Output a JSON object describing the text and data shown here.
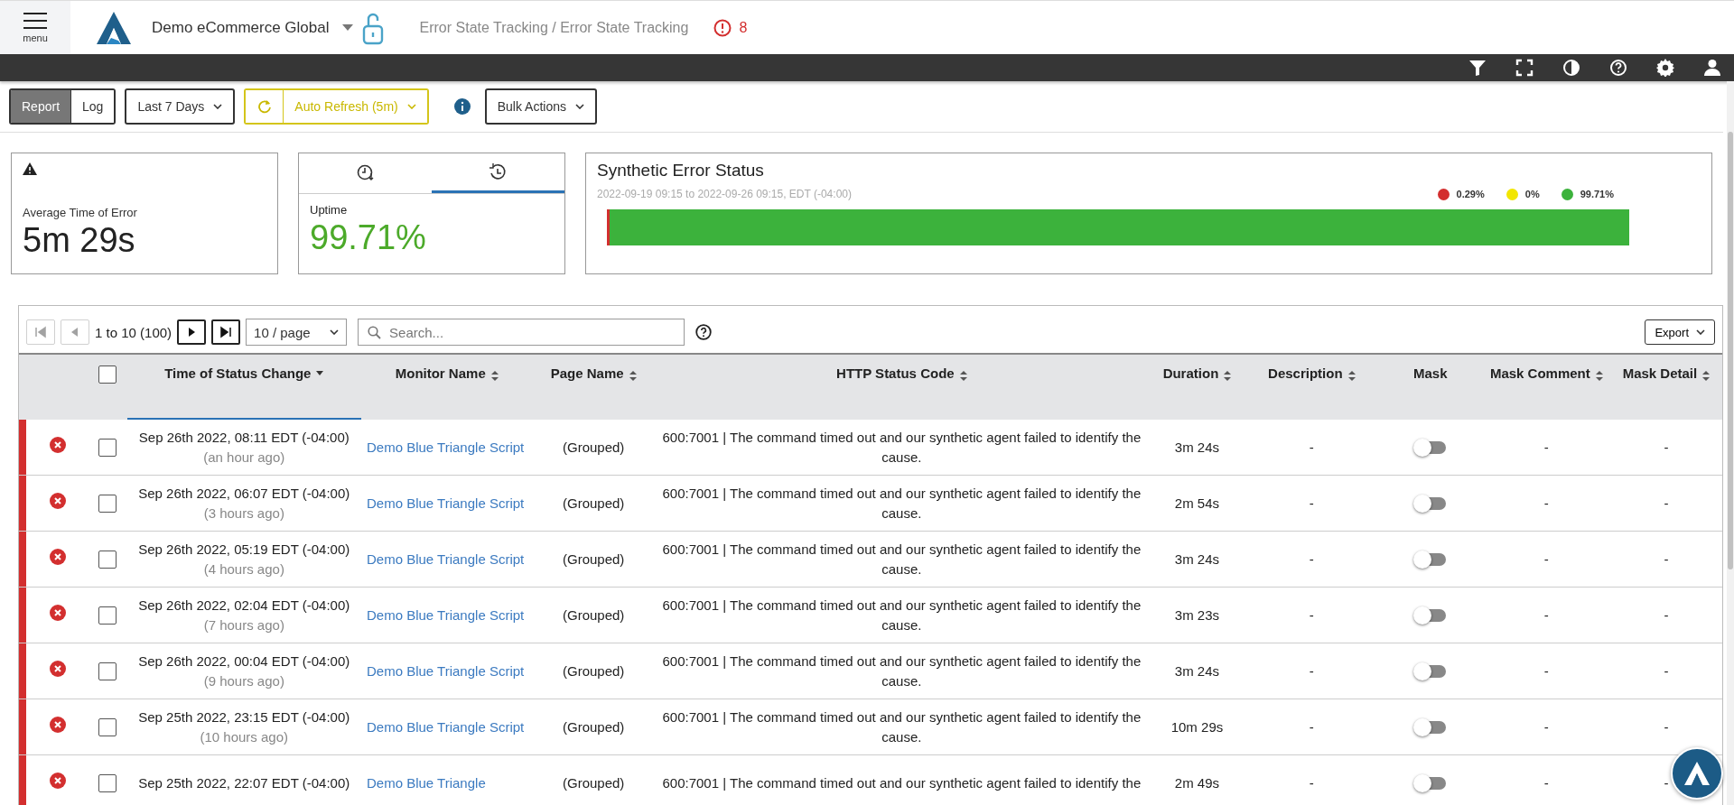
{
  "header": {
    "menu_label": "menu",
    "account": "Demo eCommerce Global",
    "breadcrumb": "Error State Tracking / Error State Tracking",
    "alert_count": "8"
  },
  "toolbar": {
    "view_toggle": [
      {
        "label": "Report",
        "selected": true
      },
      {
        "label": "Log",
        "selected": false
      }
    ],
    "date_range": "Last 7 Days",
    "auto_refresh": "Auto Refresh (5m)",
    "bulk_actions": "Bulk Actions"
  },
  "average_card": {
    "label": "Average Time of Error",
    "value": "5m 29s"
  },
  "uptime_card": {
    "tabs": [
      {
        "kind": "clock-down",
        "selected": false
      },
      {
        "kind": "clock-history",
        "selected": true
      }
    ],
    "label": "Uptime",
    "value": "99.71%"
  },
  "status_card": {
    "title": "Synthetic Error Status",
    "range": "2022-09-19 09:15 to 2022-09-26 09:15, EDT (-04:00)",
    "legend": [
      {
        "label": "0.29%",
        "color": "#d32f2f"
      },
      {
        "label": "0%",
        "color": "#f2e600"
      },
      {
        "label": "99.71%",
        "color": "#3cb23c"
      }
    ],
    "segments": [
      {
        "color": "#d32f2f",
        "level": 0.0029
      },
      {
        "color": "#3cb23c",
        "level": 0.9971
      }
    ]
  },
  "table": {
    "range": "1 to 10 (100)",
    "page_size": "10 / page",
    "search_placeholder": "Search...",
    "export": "Export",
    "all_checked": false,
    "columns": [
      {
        "label": "Time of Status Change",
        "sortable": true,
        "sorted": true
      },
      {
        "label": "Monitor Name",
        "sortable": true,
        "sorted": false
      },
      {
        "label": "Page Name",
        "sortable": true,
        "sorted": false
      },
      {
        "label": "HTTP Status Code",
        "sortable": true,
        "sorted": false
      },
      {
        "label": "Duration",
        "sortable": true,
        "sorted": false
      },
      {
        "label": "Description",
        "sortable": true,
        "sorted": false
      },
      {
        "label": "Mask",
        "sortable": false,
        "sorted": false
      },
      {
        "label": "Mask Comment",
        "sortable": true,
        "sorted": false
      },
      {
        "label": "Mask Detail",
        "sortable": true,
        "sorted": false
      }
    ],
    "rows": [
      {
        "kind": "error",
        "checked": false,
        "time": "Sep 26th 2022, 08:11 EDT (-04:00)",
        "ago": "(an hour ago)",
        "monitor": "Demo Blue Triangle Script",
        "page": "(Grouped)",
        "http": "600:7001 | The command timed out and our synthetic agent failed to identify the cause.",
        "duration": "3m 24s",
        "description": "-",
        "masked": false,
        "mask_comment": "-",
        "mask_detail": "-"
      },
      {
        "kind": "error",
        "checked": false,
        "time": "Sep 26th 2022, 06:07 EDT (-04:00)",
        "ago": "(3 hours ago)",
        "monitor": "Demo Blue Triangle Script",
        "page": "(Grouped)",
        "http": "600:7001 | The command timed out and our synthetic agent failed to identify the cause.",
        "duration": "2m 54s",
        "description": "-",
        "masked": false,
        "mask_comment": "-",
        "mask_detail": "-"
      },
      {
        "kind": "error",
        "checked": false,
        "time": "Sep 26th 2022, 05:19 EDT (-04:00)",
        "ago": "(4 hours ago)",
        "monitor": "Demo Blue Triangle Script",
        "page": "(Grouped)",
        "http": "600:7001 | The command timed out and our synthetic agent failed to identify the cause.",
        "duration": "3m 24s",
        "description": "-",
        "masked": false,
        "mask_comment": "-",
        "mask_detail": "-"
      },
      {
        "kind": "error",
        "checked": false,
        "time": "Sep 26th 2022, 02:04 EDT (-04:00)",
        "ago": "(7 hours ago)",
        "monitor": "Demo Blue Triangle Script",
        "page": "(Grouped)",
        "http": "600:7001 | The command timed out and our synthetic agent failed to identify the cause.",
        "duration": "3m 23s",
        "description": "-",
        "masked": false,
        "mask_comment": "-",
        "mask_detail": "-"
      },
      {
        "kind": "error",
        "checked": false,
        "time": "Sep 26th 2022, 00:04 EDT (-04:00)",
        "ago": "(9 hours ago)",
        "monitor": "Demo Blue Triangle Script",
        "page": "(Grouped)",
        "http": "600:7001 | The command timed out and our synthetic agent failed to identify the cause.",
        "duration": "3m 24s",
        "description": "-",
        "masked": false,
        "mask_comment": "-",
        "mask_detail": "-"
      },
      {
        "kind": "error",
        "checked": false,
        "time": "Sep 25th 2022, 23:15 EDT (-04:00)",
        "ago": "(10 hours ago)",
        "monitor": "Demo Blue Triangle Script",
        "page": "(Grouped)",
        "http": "600:7001 | The command timed out and our synthetic agent failed to identify the cause.",
        "duration": "10m 29s",
        "description": "-",
        "masked": false,
        "mask_comment": "-",
        "mask_detail": "-"
      },
      {
        "kind": "error",
        "checked": false,
        "time": "Sep 25th 2022, 22:07 EDT (-04:00)",
        "monitor": "Demo Blue Triangle",
        "page": "(Grouped)",
        "http": "600:7001 | The command timed out and our synthetic agent failed to identify the",
        "duration": "2m 49s",
        "description": "-",
        "masked": false,
        "mask_comment": "-",
        "mask_detail": "-"
      }
    ]
  }
}
